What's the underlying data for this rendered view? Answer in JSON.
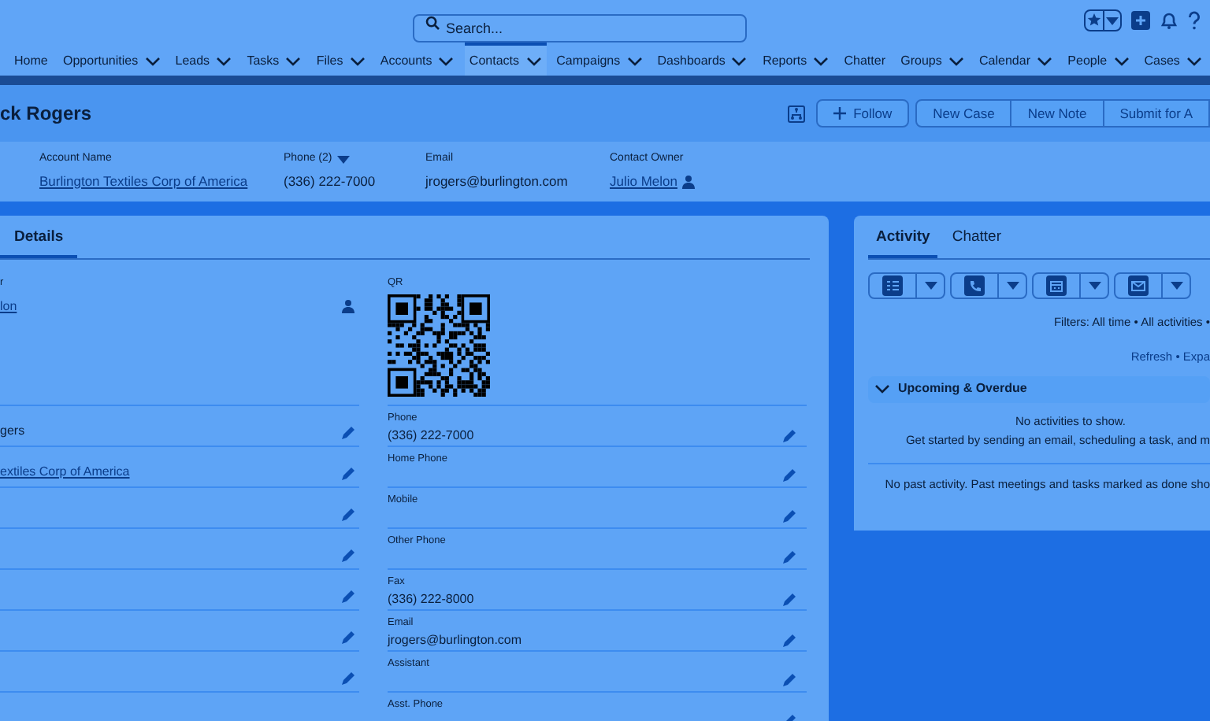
{
  "search": {
    "placeholder": "Search..."
  },
  "nav": [
    {
      "label": "Home",
      "has_menu": false,
      "selected": false
    },
    {
      "label": "Opportunities",
      "has_menu": true,
      "selected": false
    },
    {
      "label": "Leads",
      "has_menu": true,
      "selected": false
    },
    {
      "label": "Tasks",
      "has_menu": true,
      "selected": false
    },
    {
      "label": "Files",
      "has_menu": true,
      "selected": false
    },
    {
      "label": "Accounts",
      "has_menu": true,
      "selected": false
    },
    {
      "label": "Contacts",
      "has_menu": true,
      "selected": true
    },
    {
      "label": "Campaigns",
      "has_menu": true,
      "selected": false
    },
    {
      "label": "Dashboards",
      "has_menu": true,
      "selected": false
    },
    {
      "label": "Reports",
      "has_menu": true,
      "selected": false
    },
    {
      "label": "Chatter",
      "has_menu": false,
      "selected": false
    },
    {
      "label": "Groups",
      "has_menu": true,
      "selected": false
    },
    {
      "label": "Calendar",
      "has_menu": true,
      "selected": false
    },
    {
      "label": "People",
      "has_menu": true,
      "selected": false
    },
    {
      "label": "Cases",
      "has_menu": true,
      "selected": false
    }
  ],
  "record": {
    "title": "ck Rogers",
    "actions": [
      "Follow",
      "New Case",
      "New Note",
      "Submit for A"
    ]
  },
  "highlights": [
    {
      "label": "Account Name",
      "value": "Burlington Textiles Corp of America",
      "kind": "link"
    },
    {
      "label": "Phone (2)",
      "value": "(336) 222-7000",
      "kind": "dropdown"
    },
    {
      "label": "Email",
      "value": "jrogers@burlington.com",
      "kind": "text"
    },
    {
      "label": "Contact Owner",
      "value": "Julio Melon",
      "kind": "owner"
    }
  ],
  "details": {
    "tab": "Details",
    "owner_field": {
      "label": "r",
      "value": "lon"
    },
    "qr_label": "QR",
    "rows": [
      {
        "left": "gers",
        "left_link": false,
        "right_label": "Phone",
        "right_value": "(336) 222-7000"
      },
      {
        "left": "extiles Corp of America",
        "left_link": true,
        "right_label": "Home Phone"
      },
      {
        "right_label": "Mobile"
      },
      {
        "right_label": "Other Phone"
      },
      {
        "right_label": "Fax",
        "right_value": "(336) 222-8000"
      },
      {
        "right_label": "Email",
        "right_value": "jrogers@burlington.com"
      },
      {
        "right_label": "Assistant"
      },
      {
        "right_label": "Asst. Phone"
      }
    ]
  },
  "activity": {
    "tabs": [
      {
        "label": "Activity",
        "selected": true
      },
      {
        "label": "Chatter",
        "selected": false
      }
    ],
    "filters": "Filters: All time • All activities •",
    "links": "Refresh • Expa",
    "section": "Upcoming & Overdue",
    "empty_title": "No activities to show.",
    "empty_hint": "Get started by sending an email, scheduling a task, and m",
    "past": "No past activity. Past meetings and tasks marked as done sho"
  }
}
